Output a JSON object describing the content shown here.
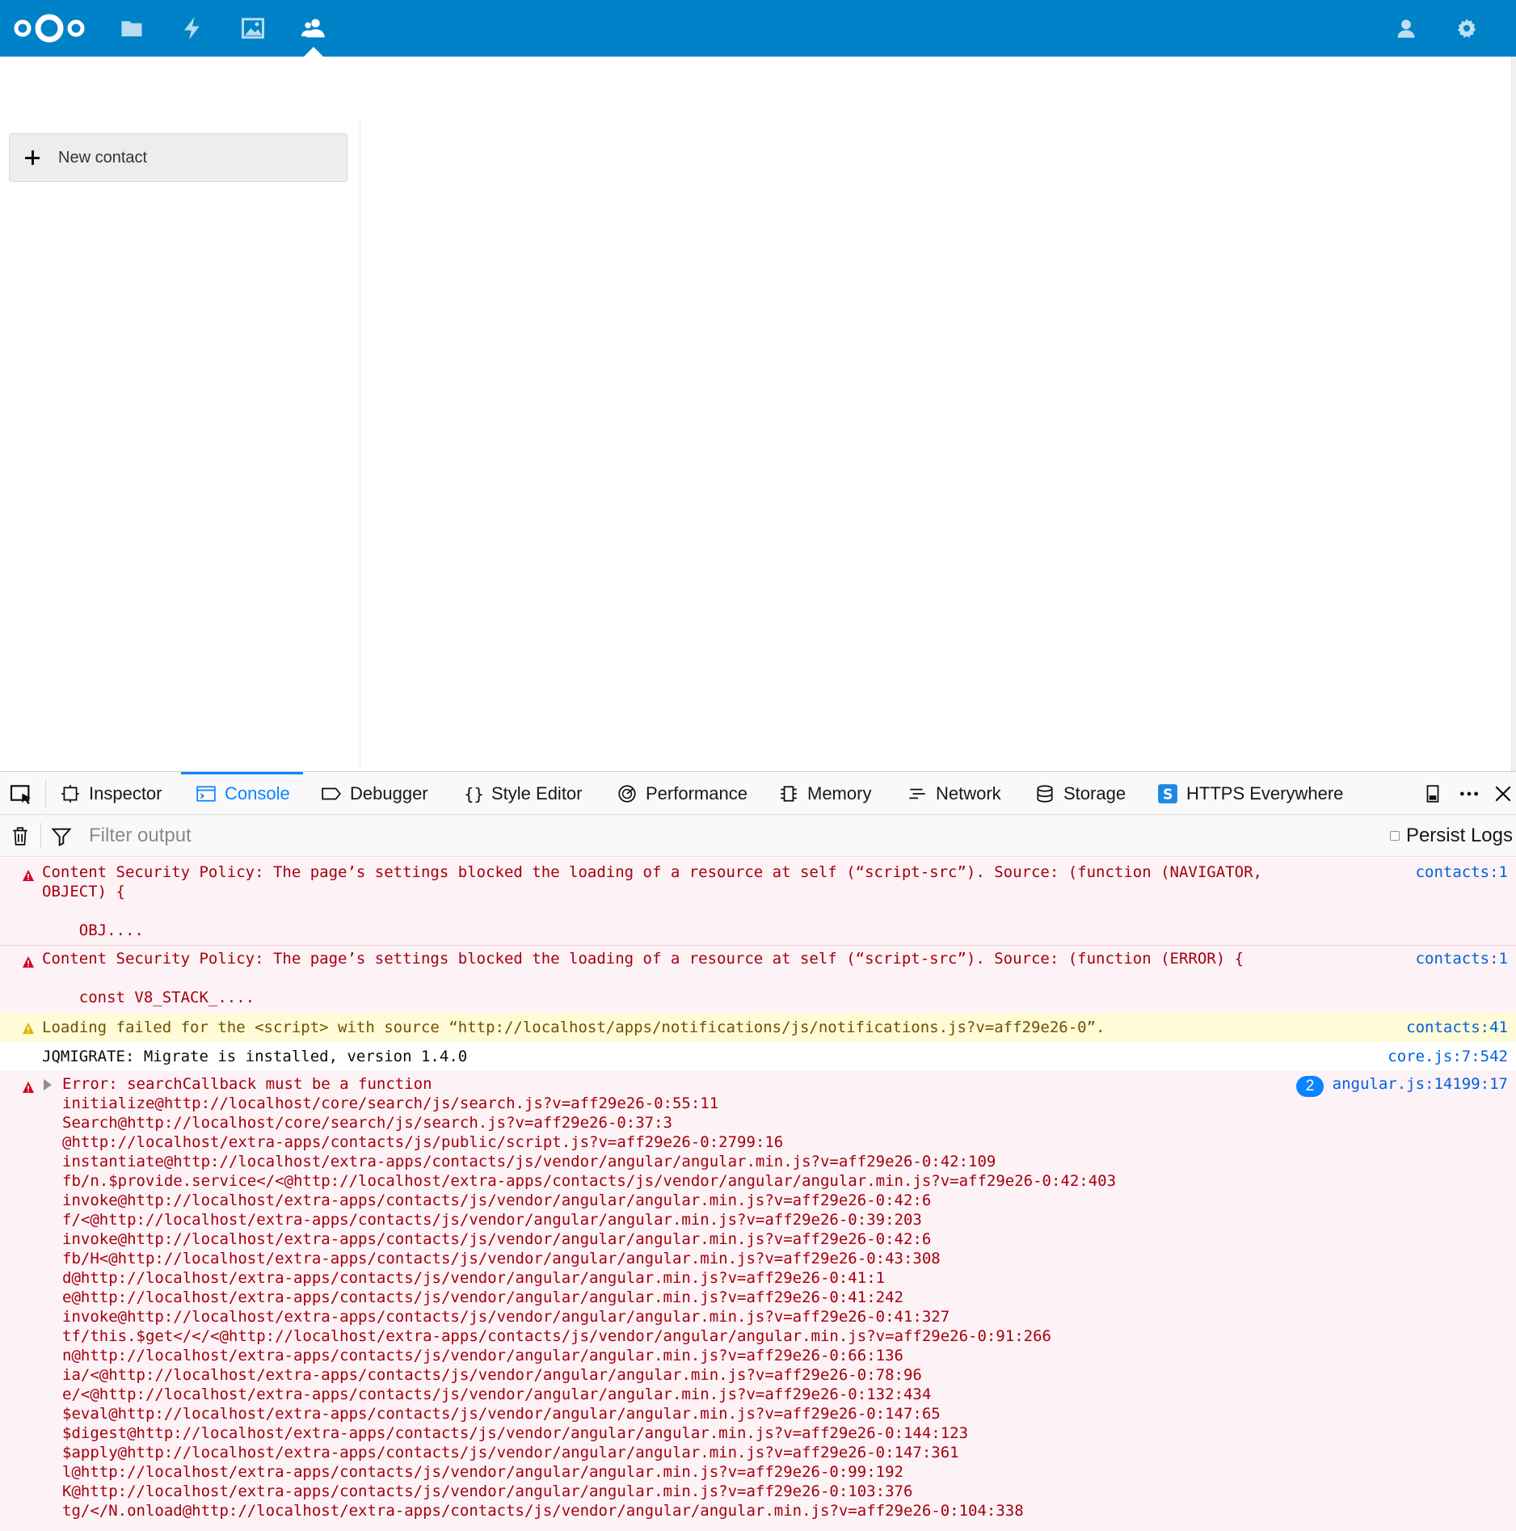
{
  "header": {
    "logo_icon": "nextcloud-logo",
    "apps": [
      {
        "name": "files",
        "icon": "folder-icon"
      },
      {
        "name": "activity",
        "icon": "lightning-icon"
      },
      {
        "name": "gallery",
        "icon": "image-icon"
      },
      {
        "name": "contacts",
        "icon": "contacts-icon",
        "active": true
      }
    ],
    "right_icons": [
      "user-icon",
      "gear-icon"
    ],
    "brand_color": "#0082c9"
  },
  "contacts": {
    "new_contact_label": "New contact"
  },
  "devtools": {
    "tabs": [
      {
        "label": "Inspector",
        "icon": "inspector-icon"
      },
      {
        "label": "Console",
        "icon": "console-icon",
        "active": true
      },
      {
        "label": "Debugger",
        "icon": "debugger-icon"
      },
      {
        "label": "Style Editor",
        "icon": "braces-icon"
      },
      {
        "label": "Performance",
        "icon": "gauge-icon"
      },
      {
        "label": "Memory",
        "icon": "chip-icon"
      },
      {
        "label": "Network",
        "icon": "network-icon"
      },
      {
        "label": "Storage",
        "icon": "database-icon"
      },
      {
        "label": "HTTPS Everywhere",
        "icon": "https-everywhere-icon"
      }
    ],
    "filter": {
      "placeholder": "Filter output",
      "persist_label": "Persist Logs"
    },
    "messages": [
      {
        "level": "error",
        "lines": [
          "Content Security Policy: The page’s settings blocked the loading of a resource at self (“script-src”). Source: (function (NAVIGATOR,",
          "OBJECT) {",
          "",
          "    OBJ...."
        ],
        "location": "contacts:1"
      },
      {
        "level": "error",
        "lines": [
          "Content Security Policy: The page’s settings blocked the loading of a resource at self (“script-src”). Source: (function (ERROR) {",
          "",
          "    const V8_STACK_...."
        ],
        "location": "contacts:1"
      },
      {
        "level": "warn",
        "lines": [
          "Loading failed for the <script> with source “http://localhost/apps/notifications/js/notifications.js?v=aff29e26-0”."
        ],
        "location": "contacts:41"
      },
      {
        "level": "log",
        "lines": [
          "JQMIGRATE: Migrate is installed, version 1.4.0"
        ],
        "location": "core.js:7:542"
      },
      {
        "level": "error",
        "title": "Error: searchCallback must be a function",
        "repeat": "2",
        "location": "angular.js:14199:17",
        "stack": [
          "initialize@http://localhost/core/search/js/search.js?v=aff29e26-0:55:11",
          "Search@http://localhost/core/search/js/search.js?v=aff29e26-0:37:3",
          "@http://localhost/extra-apps/contacts/js/public/script.js?v=aff29e26-0:2799:16",
          "instantiate@http://localhost/extra-apps/contacts/js/vendor/angular/angular.min.js?v=aff29e26-0:42:109",
          "fb/n.$provide.service</<@http://localhost/extra-apps/contacts/js/vendor/angular/angular.min.js?v=aff29e26-0:42:403",
          "invoke@http://localhost/extra-apps/contacts/js/vendor/angular/angular.min.js?v=aff29e26-0:42:6",
          "f/<@http://localhost/extra-apps/contacts/js/vendor/angular/angular.min.js?v=aff29e26-0:39:203",
          "invoke@http://localhost/extra-apps/contacts/js/vendor/angular/angular.min.js?v=aff29e26-0:42:6",
          "fb/H<@http://localhost/extra-apps/contacts/js/vendor/angular/angular.min.js?v=aff29e26-0:43:308",
          "d@http://localhost/extra-apps/contacts/js/vendor/angular/angular.min.js?v=aff29e26-0:41:1",
          "e@http://localhost/extra-apps/contacts/js/vendor/angular/angular.min.js?v=aff29e26-0:41:242",
          "invoke@http://localhost/extra-apps/contacts/js/vendor/angular/angular.min.js?v=aff29e26-0:41:327",
          "tf/this.$get</</<@http://localhost/extra-apps/contacts/js/vendor/angular/angular.min.js?v=aff29e26-0:91:266",
          "n@http://localhost/extra-apps/contacts/js/vendor/angular/angular.min.js?v=aff29e26-0:66:136",
          "ia/<@http://localhost/extra-apps/contacts/js/vendor/angular/angular.min.js?v=aff29e26-0:78:96",
          "e/<@http://localhost/extra-apps/contacts/js/vendor/angular/angular.min.js?v=aff29e26-0:132:434",
          "$eval@http://localhost/extra-apps/contacts/js/vendor/angular/angular.min.js?v=aff29e26-0:147:65",
          "$digest@http://localhost/extra-apps/contacts/js/vendor/angular/angular.min.js?v=aff29e26-0:144:123",
          "$apply@http://localhost/extra-apps/contacts/js/vendor/angular/angular.min.js?v=aff29e26-0:147:361",
          "l@http://localhost/extra-apps/contacts/js/vendor/angular/angular.min.js?v=aff29e26-0:99:192",
          "K@http://localhost/extra-apps/contacts/js/vendor/angular/angular.min.js?v=aff29e26-0:103:376",
          "tg/</N.onload@http://localhost/extra-apps/contacts/js/vendor/angular/angular.min.js?v=aff29e26-0:104:338"
        ]
      }
    ],
    "colors": {
      "accent": "#0a84ff",
      "error_bg": "#fdf2f5",
      "error_text": "#a4000f",
      "warn_bg": "#fffbd6",
      "link": "#0060df"
    }
  }
}
